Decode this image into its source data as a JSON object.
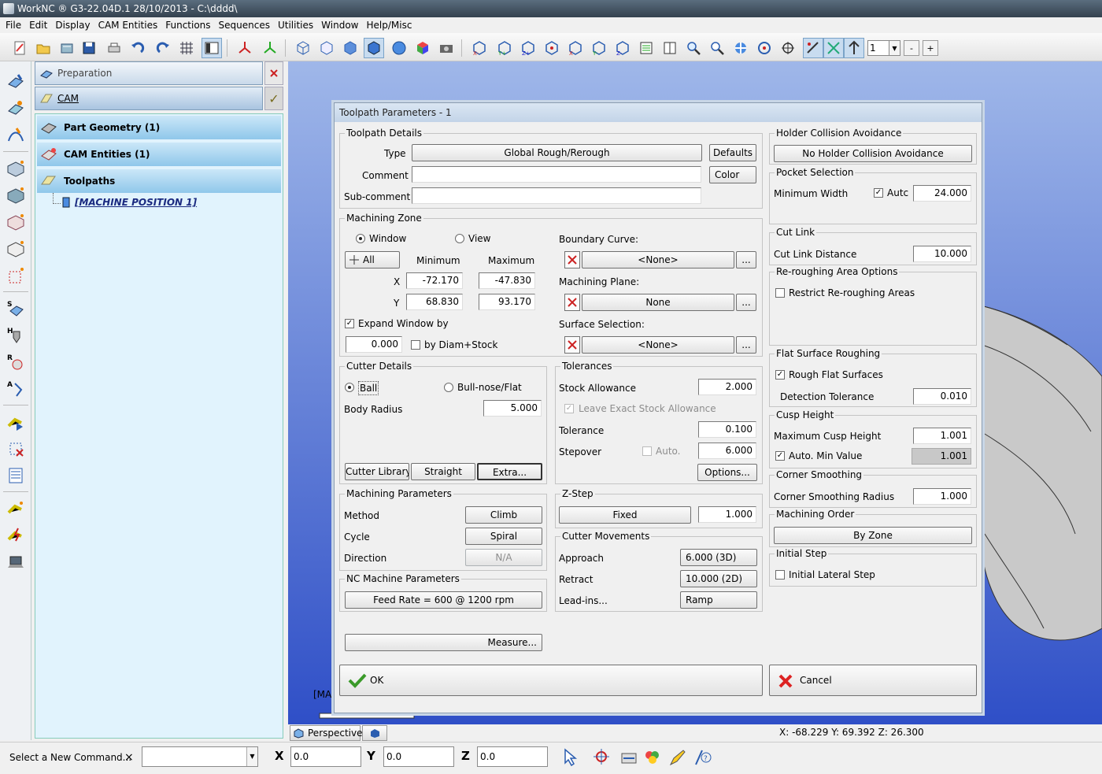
{
  "window": {
    "title": "WorkNC ® G3-22.04D.1   28/10/2013  - C:\\dddd\\"
  },
  "menu": [
    "File",
    "Edit",
    "Display",
    "CAM Entities",
    "Functions",
    "Sequences",
    "Utilities",
    "Window",
    "Help/Misc"
  ],
  "toolbar": {
    "layer_value": "1",
    "minus_label": "-",
    "plus_label": "+"
  },
  "panel": {
    "preparation_label": "Preparation",
    "cam_label": "CAM",
    "tree": {
      "part_geometry": "Part Geometry (1)",
      "cam_entities": "CAM Entities (1)",
      "toolpaths": "Toolpaths",
      "machine_position": "[MACHINE POSITION  1]"
    }
  },
  "viewport": {
    "partial_label": "[MA",
    "view_tab": "Perspective"
  },
  "status": {
    "coords": "X: -68.229   Y: 69.392   Z: 26.300"
  },
  "bottom": {
    "command_prompt": "Select a New Command...",
    "close_glyph": "×",
    "command_value": "",
    "x_label": "X",
    "x_value": "0.0",
    "y_label": "Y",
    "y_value": "0.0",
    "z_label": "Z",
    "z_value": "0.0"
  },
  "dialog": {
    "title": "Toolpath Parameters - 1",
    "toolpath_details": {
      "group": "Toolpath Details",
      "type_label": "Type",
      "type_value": "Global Rough/Rerough",
      "defaults_btn": "Defaults",
      "comment_label": "Comment",
      "comment_value": "",
      "color_btn": "Color",
      "subcomment_label": "Sub-comment",
      "subcomment_value": ""
    },
    "machining_zone": {
      "group": "Machining Zone",
      "window_label": "Window",
      "view_label": "View",
      "all_btn": "All",
      "minimum_label": "Minimum",
      "maximum_label": "Maximum",
      "x_label": "X",
      "x_min": "-72.170",
      "x_max": "-47.830",
      "y_label": "Y",
      "y_min": "68.830",
      "y_max": "93.170",
      "expand_label": "Expand Window by",
      "expand_value": "0.000",
      "diam_label": "by Diam+Stock",
      "boundary_label": "Boundary Curve:",
      "boundary_value": "<None>",
      "plane_label": "Machining Plane:",
      "plane_value": "None",
      "surface_label": "Surface Selection:",
      "surface_value": "<None>",
      "browse_btn": "..."
    },
    "cutter_details": {
      "group": "Cutter Details",
      "ball_label": "Ball",
      "bullnose_label": "Bull-nose/Flat",
      "body_radius_label": "Body Radius",
      "body_radius_value": "5.000",
      "library_btn": "Cutter Library",
      "straight_btn": "Straight",
      "extra_btn": "Extra..."
    },
    "tolerances": {
      "group": "Tolerances",
      "stock_label": "Stock Allowance",
      "stock_value": "2.000",
      "exact_label": "Leave Exact Stock Allowance",
      "tolerance_label": "Tolerance",
      "tolerance_value": "0.100",
      "stepover_label": "Stepover",
      "auto_label": "Auto.",
      "stepover_value": "6.000",
      "options_btn": "Options..."
    },
    "machining_params": {
      "group": "Machining Parameters",
      "method_label": "Method",
      "method_value": "Climb",
      "cycle_label": "Cycle",
      "cycle_value": "Spiral",
      "direction_label": "Direction",
      "direction_value": "N/A"
    },
    "zstep": {
      "group": "Z-Step",
      "mode_btn": "Fixed",
      "value": "1.000"
    },
    "cutter_movements": {
      "group": "Cutter Movements",
      "approach_label": "Approach",
      "approach_value": "6.000 (3D)",
      "retract_label": "Retract",
      "retract_value": "10.000 (2D)",
      "leadins_label": "Lead-ins...",
      "leadins_value": "Ramp"
    },
    "nc_machine": {
      "group": "NC Machine Parameters",
      "feed_btn": "Feed Rate = 600 @ 1200 rpm"
    },
    "measure_btn": "Measure...",
    "holder": {
      "group": "Holder Collision Avoidance",
      "btn": "No Holder Collision Avoidance"
    },
    "pocket": {
      "group": "Pocket Selection",
      "min_width_label": "Minimum Width",
      "auto_label": "Autc",
      "min_width_value": "24.000"
    },
    "cut_link": {
      "group": "Cut Link",
      "distance_label": "Cut Link Distance",
      "distance_value": "10.000"
    },
    "rerough": {
      "group": "Re-roughing Area Options",
      "restrict_label": "Restrict Re-roughing Areas"
    },
    "flat_surface": {
      "group": "Flat Surface Roughing",
      "rough_label": "Rough Flat Surfaces",
      "detection_label": "Detection Tolerance",
      "detection_value": "0.010"
    },
    "cusp": {
      "group": "Cusp Height",
      "max_label": "Maximum Cusp Height",
      "max_value": "1.001",
      "auto_min_label": "Auto. Min Value",
      "auto_min_value": "1.001"
    },
    "corner": {
      "group": "Corner Smoothing",
      "radius_label": "Corner Smoothing Radius",
      "radius_value": "1.000"
    },
    "order": {
      "group": "Machining Order",
      "btn": "By Zone"
    },
    "initial_step": {
      "group": "Initial Step",
      "lateral_label": "Initial Lateral Step"
    },
    "ok_btn": "OK",
    "cancel_btn": "Cancel",
    "check_glyph": "✓"
  }
}
